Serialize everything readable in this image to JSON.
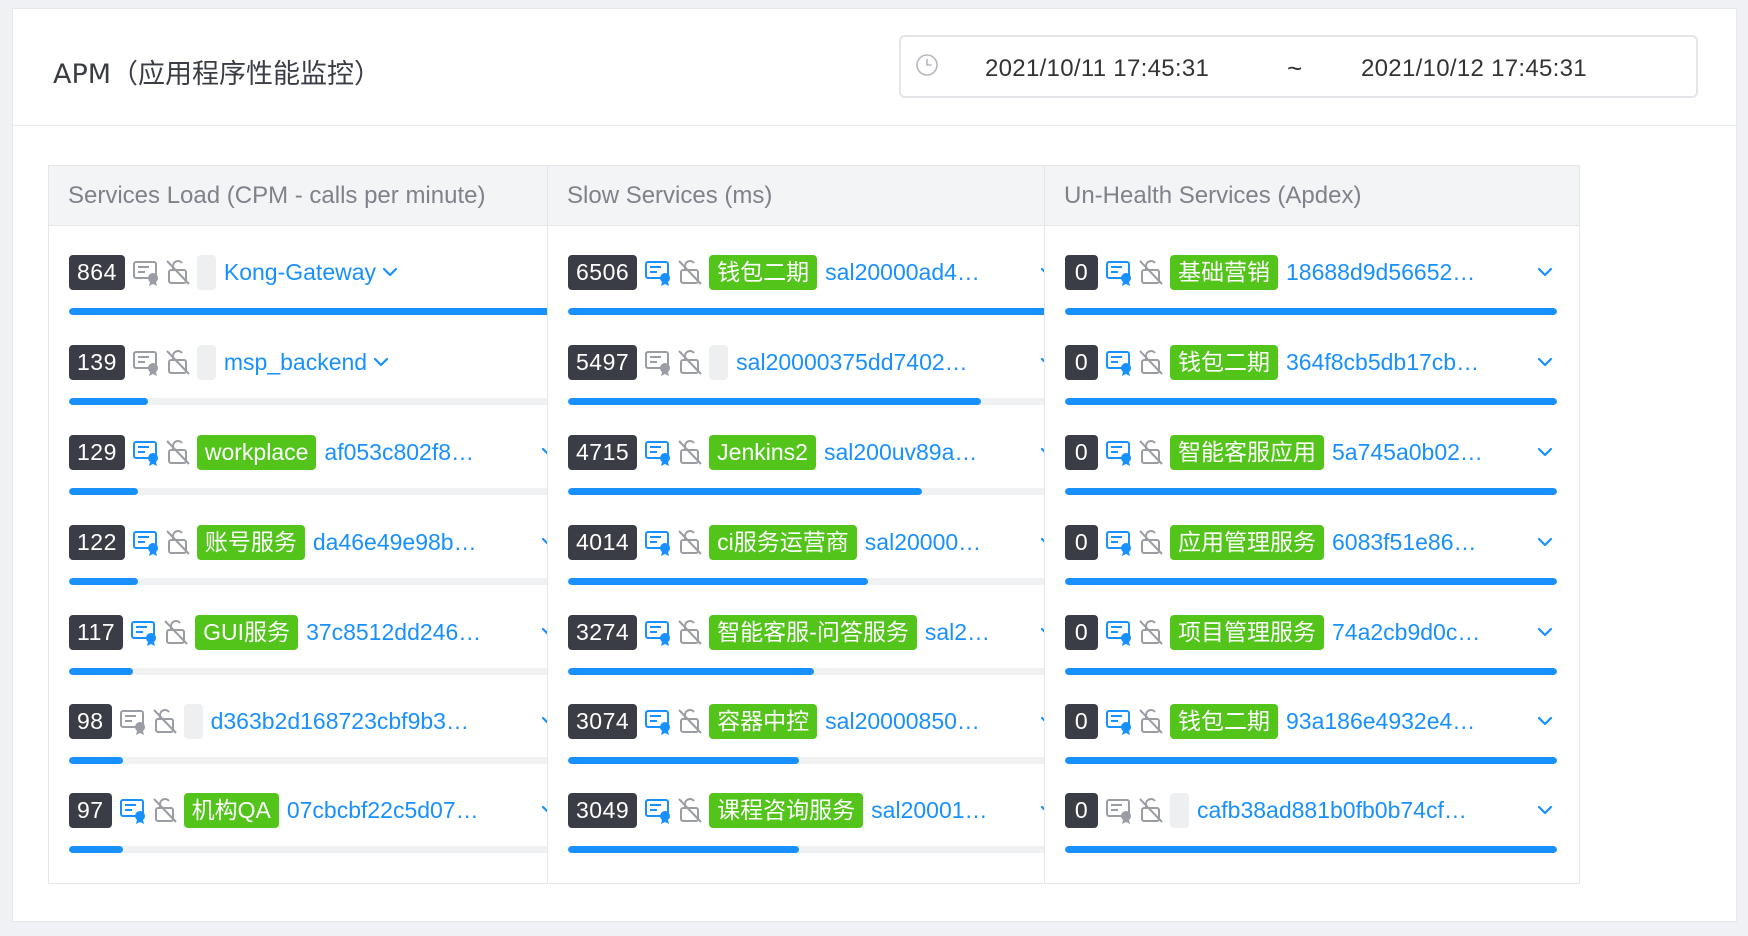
{
  "page": {
    "title": "APM（应用程序性能监控）",
    "range_start": "2021/10/11 17:45:31",
    "range_sep": "~",
    "range_end": "2021/10/12 17:45:31"
  },
  "colors": {
    "accent": "#1890ff",
    "tag": "#52c41a",
    "count_badge": "#3a3d46"
  },
  "panels": [
    {
      "title": "Services Load (CPM - calls per minute)",
      "items": [
        {
          "count": "864",
          "tag": "",
          "service": "Kong-Gateway",
          "progress": 1.0,
          "icon_active": false,
          "fit": true
        },
        {
          "count": "139",
          "tag": "",
          "service": "msp_backend",
          "progress": 0.16,
          "icon_active": false,
          "fit": true
        },
        {
          "count": "129",
          "tag": "workplace",
          "service": "af053c802f8…",
          "progress": 0.14,
          "icon_active": true
        },
        {
          "count": "122",
          "tag": "账号服务",
          "service": "da46e49e98b…",
          "progress": 0.14,
          "icon_active": true
        },
        {
          "count": "117",
          "tag": "GUI服务",
          "service": "37c8512dd246…",
          "progress": 0.13,
          "icon_active": true
        },
        {
          "count": "98",
          "tag": "",
          "service": "d363b2d168723cbf9b3…",
          "progress": 0.11,
          "icon_active": false
        },
        {
          "count": "97",
          "tag": "机构QA",
          "service": "07cbcbf22c5d07…",
          "progress": 0.11,
          "icon_active": true
        }
      ]
    },
    {
      "title": "Slow Services (ms)",
      "items": [
        {
          "count": "6506",
          "tag": "钱包二期",
          "service": "sal20000ad4…",
          "progress": 1.0,
          "icon_active": true
        },
        {
          "count": "5497",
          "tag": "",
          "service": "sal20000375dd7402…",
          "progress": 0.84,
          "icon_active": false
        },
        {
          "count": "4715",
          "tag": "Jenkins2",
          "service": "sal200uv89a…",
          "progress": 0.72,
          "icon_active": true
        },
        {
          "count": "4014",
          "tag": "ci服务运营商",
          "service": "sal20000…",
          "progress": 0.61,
          "icon_active": true
        },
        {
          "count": "3274",
          "tag": "智能客服-问答服务",
          "service": "sal2…",
          "progress": 0.5,
          "icon_active": true
        },
        {
          "count": "3074",
          "tag": "容器中控",
          "service": "sal20000850…",
          "progress": 0.47,
          "icon_active": true
        },
        {
          "count": "3049",
          "tag": "课程咨询服务",
          "service": "sal20001…",
          "progress": 0.47,
          "icon_active": true
        }
      ]
    },
    {
      "title": "Un-Health Services (Apdex)",
      "items": [
        {
          "count": "0",
          "tag": "基础营销",
          "service": "18688d9d56652…",
          "progress": 1.0,
          "icon_active": true
        },
        {
          "count": "0",
          "tag": "钱包二期",
          "service": "364f8cb5db17cb…",
          "progress": 1.0,
          "icon_active": true
        },
        {
          "count": "0",
          "tag": "智能客服应用",
          "service": "5a745a0b02…",
          "progress": 1.0,
          "icon_active": true
        },
        {
          "count": "0",
          "tag": "应用管理服务",
          "service": "6083f51e86…",
          "progress": 1.0,
          "icon_active": true
        },
        {
          "count": "0",
          "tag": "项目管理服务",
          "service": "74a2cb9d0c…",
          "progress": 1.0,
          "icon_active": true
        },
        {
          "count": "0",
          "tag": "钱包二期",
          "service": "93a186e4932e4…",
          "progress": 1.0,
          "icon_active": true
        },
        {
          "count": "0",
          "tag": "",
          "service": "cafb38ad881b0fb0b74cf…",
          "progress": 1.0,
          "icon_active": false
        }
      ]
    }
  ]
}
